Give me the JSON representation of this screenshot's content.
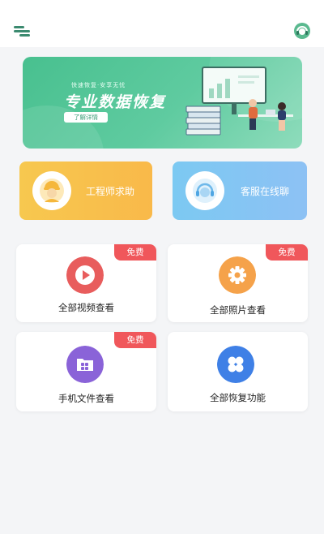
{
  "header": {
    "menu_icon": "menu-icon",
    "support_icon": "customer-service-icon",
    "accent": "#3b8a6f"
  },
  "banner": {
    "subtitle": "快速恢复·安享无忧",
    "title": "专业数据恢复",
    "button": "了解详情"
  },
  "services": [
    {
      "label": "工程师求助",
      "icon": "engineer-icon"
    },
    {
      "label": "客服在线聊",
      "icon": "headset-icon"
    }
  ],
  "features": [
    {
      "label": "全部视频查看",
      "badge": "免费",
      "icon": "play-icon",
      "color": "#e85d5d"
    },
    {
      "label": "全部照片查看",
      "badge": "免费",
      "icon": "gear-icon",
      "color": "#f5a24a"
    },
    {
      "label": "手机文件查看",
      "badge": "免费",
      "icon": "folder-icon",
      "color": "#8a63d8"
    },
    {
      "label": "全部恢复功能",
      "icon": "grid-icon",
      "color": "#3f80e6"
    }
  ]
}
